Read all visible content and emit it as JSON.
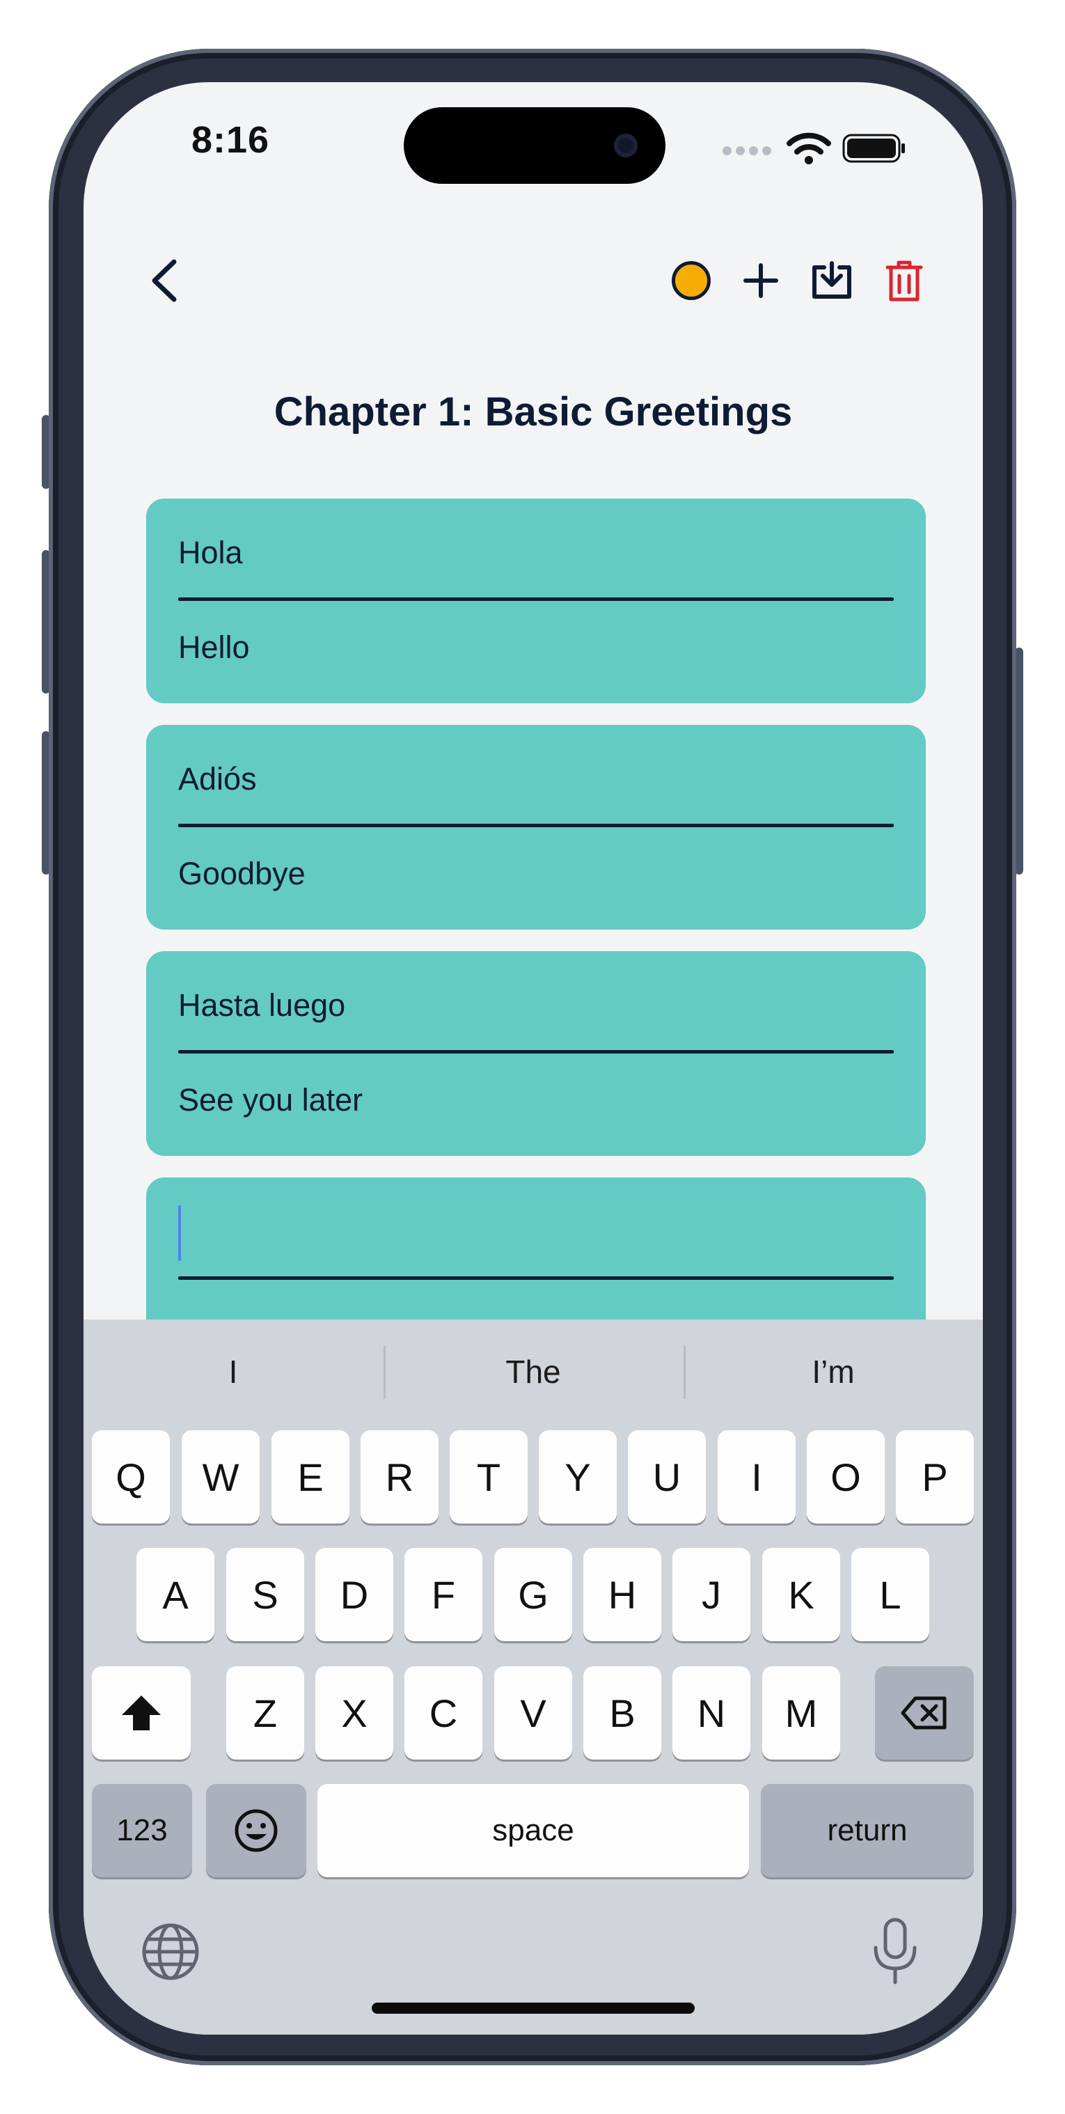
{
  "status": {
    "time": "8:16"
  },
  "toolbar": {
    "back_icon": "chevron-left-icon",
    "status_dot_color": "#f5ad05",
    "add_icon": "plus-icon",
    "save_icon": "download-icon",
    "delete_icon": "trash-icon",
    "delete_color": "#d8262c"
  },
  "page": {
    "title": "Chapter 1: Basic Greetings"
  },
  "cards": [
    {
      "front": "Hola",
      "back": "Hello"
    },
    {
      "front": "Adiós",
      "back": "Goodbye"
    },
    {
      "front": "Hasta luego",
      "back": "See you later"
    },
    {
      "front": "",
      "back": ""
    }
  ],
  "keyboard": {
    "suggestions": [
      "I",
      "The",
      "I’m"
    ],
    "row1": [
      "Q",
      "W",
      "E",
      "R",
      "T",
      "Y",
      "U",
      "I",
      "O",
      "P"
    ],
    "row2": [
      "A",
      "S",
      "D",
      "F",
      "G",
      "H",
      "J",
      "K",
      "L"
    ],
    "row3": [
      "Z",
      "X",
      "C",
      "V",
      "B",
      "N",
      "M"
    ],
    "numbers_label": "123",
    "space_label": "space",
    "return_label": "return"
  },
  "colors": {
    "card": "#63cbc3",
    "ink": "#0f1b33",
    "background": "#f3f4f6"
  }
}
